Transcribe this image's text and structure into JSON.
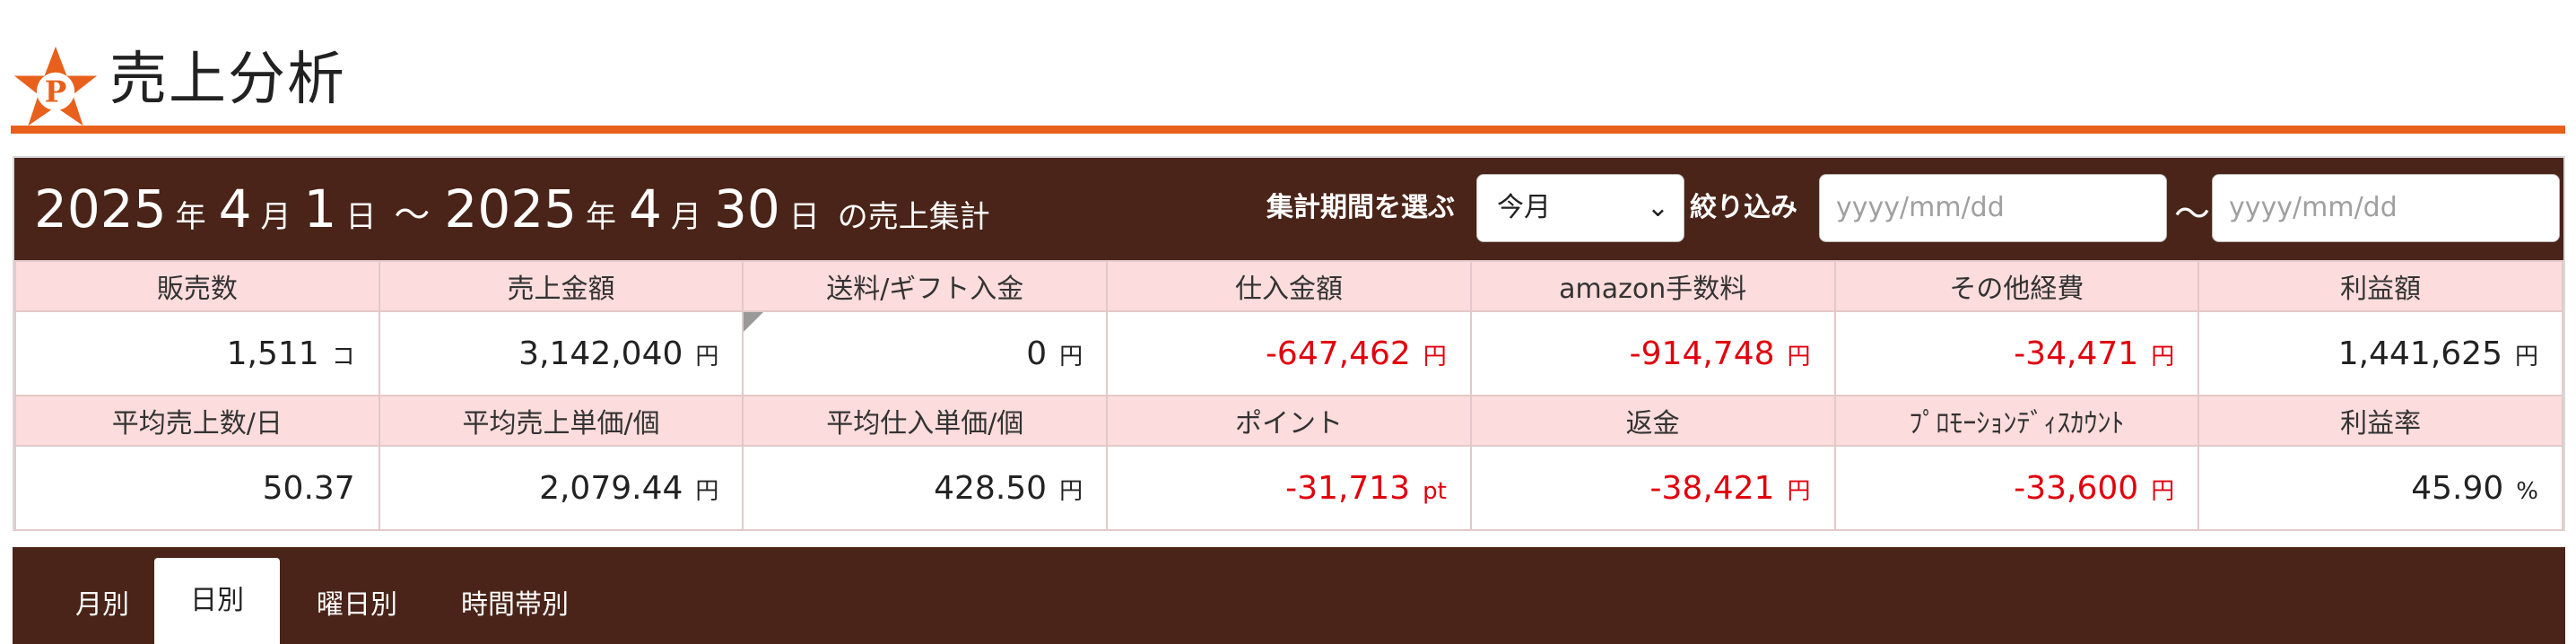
{
  "page": {
    "title": "売上分析"
  },
  "summary": {
    "date_range": {
      "start_year": "2025",
      "year_char_1": "年",
      "start_month": "4",
      "month_char_1": "月",
      "start_day": "1",
      "day_char_1": "日",
      "tilde": "～",
      "end_year": "2025",
      "year_char_2": "年",
      "end_month": "4",
      "month_char_2": "月",
      "end_day": "30",
      "day_char_2": "日",
      "suffix": "の売上集計"
    },
    "period_label": "集計期間を選ぶ",
    "period_selected": "今月",
    "filter_label": "絞り込み",
    "date_from_placeholder": "yyyy/mm/dd",
    "range_tilde": "～",
    "date_to_placeholder": "yyyy/mm/dd"
  },
  "stats": {
    "row1_headers": [
      "販売数",
      "売上金額",
      "送料/ギフト入金",
      "仕入金額",
      "amazon手数料",
      "その他経費",
      "利益額"
    ],
    "row1_values": [
      "1,511",
      "3,142,040",
      "0",
      "-647,462",
      "-914,748",
      "-34,471",
      "1,441,625"
    ],
    "row1_units": [
      "コ",
      "円",
      "円",
      "円",
      "円",
      "円",
      "円"
    ],
    "row2_headers": [
      "平均売上数/日",
      "平均売上単価/個",
      "平均仕入単価/個",
      "ポイント",
      "返金",
      "ﾌﾟﾛﾓｰｼｮﾝﾃﾞｨｽｶｳﾝﾄ",
      "利益率"
    ],
    "row2_values": [
      "50.37",
      "2,079.44",
      "428.50",
      "-31,713",
      "-38,421",
      "-33,600",
      "45.90"
    ],
    "row2_units": [
      "",
      "円",
      "円",
      "pt",
      "円",
      "円",
      "%"
    ]
  },
  "colors": {
    "accent": "#e8601c",
    "bar": "#4a2418",
    "header_row": "#fcdcdc",
    "negative": "#e0000d"
  },
  "tabs": {
    "items": [
      {
        "label": "月別"
      },
      {
        "label": "日別"
      },
      {
        "label": "曜日別"
      },
      {
        "label": "時間帯別"
      }
    ],
    "active": "日別"
  },
  "icons": {
    "logo": "star-p-logo-icon",
    "select": "chevron-down-icon"
  }
}
